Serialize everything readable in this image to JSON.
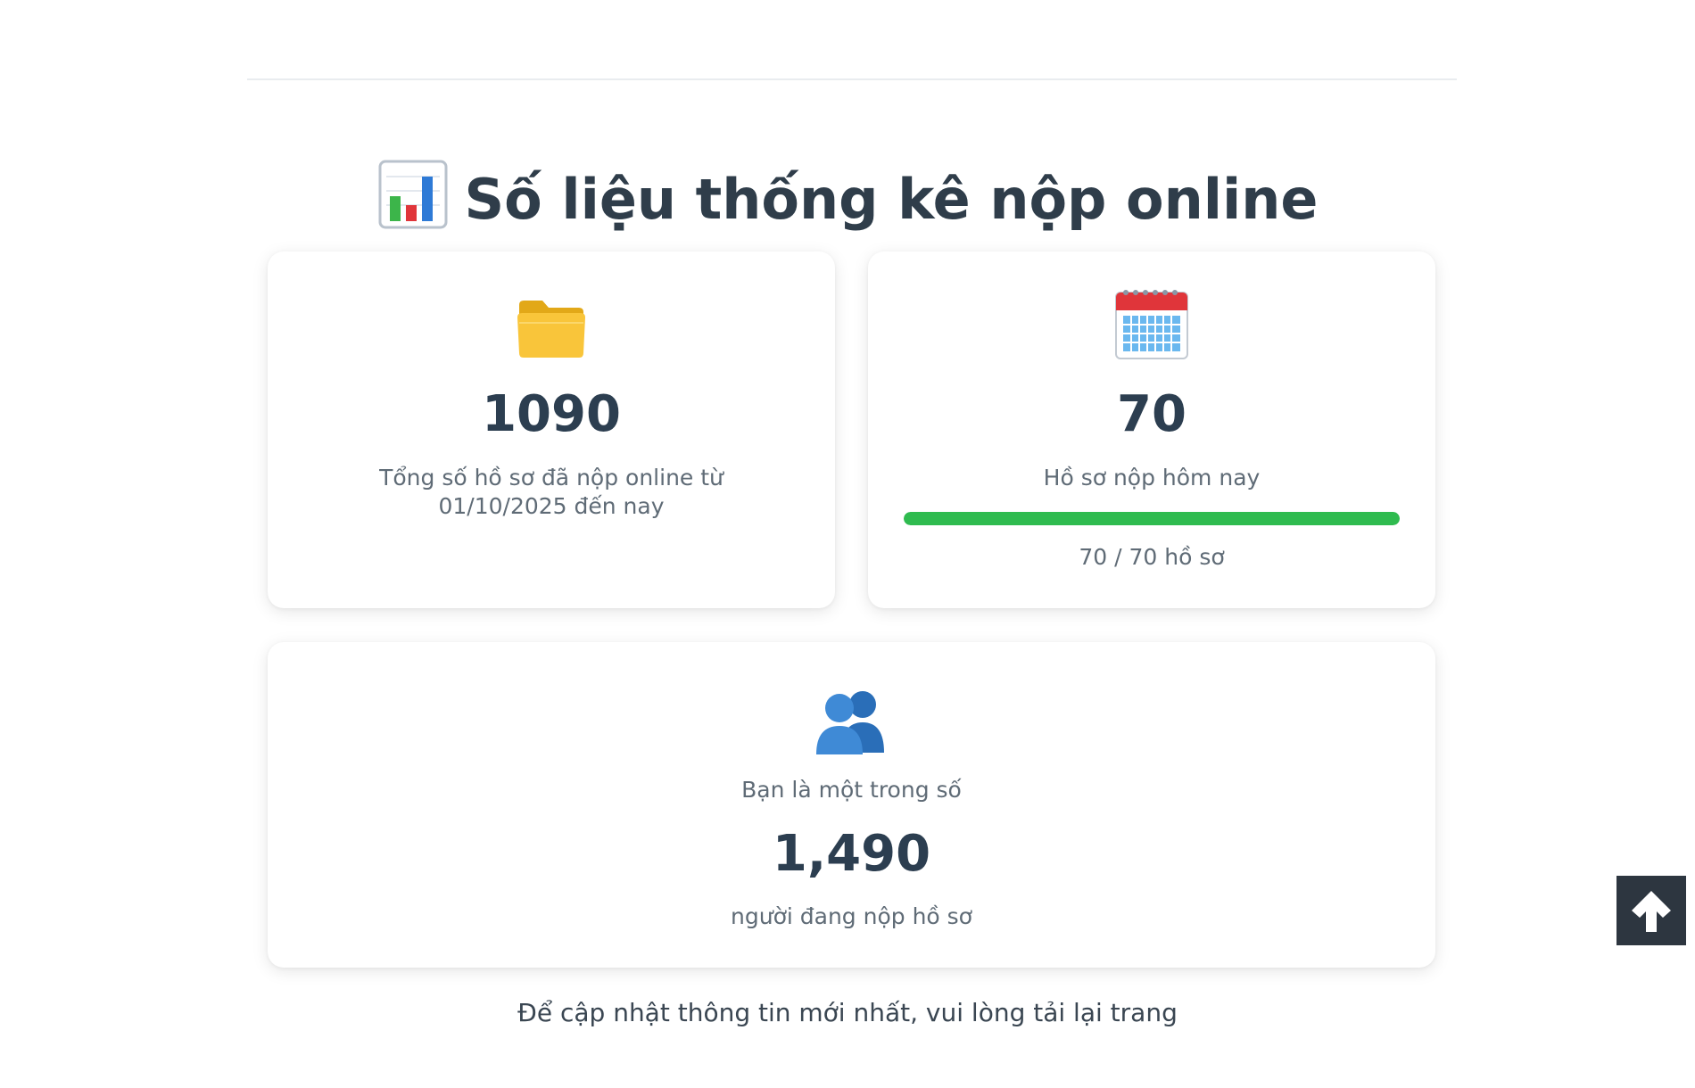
{
  "header": {
    "title": "Số liệu thống kê nộp online",
    "icon": "bar-chart-icon"
  },
  "cards": {
    "total": {
      "icon": "folder-icon",
      "value": "1090",
      "description": "Tổng số hồ sơ đã nộp online từ 01/10/2025 đến nay"
    },
    "today": {
      "icon": "calendar-icon",
      "value": "70",
      "description": "Hồ sơ nộp hôm nay",
      "progress_fraction": 1.0,
      "progress_text": "70 / 70 hồ sơ",
      "progress_color": "#2fbb4f"
    },
    "users": {
      "icon": "people-icon",
      "lead": "Bạn là một trong số",
      "value": "1,490",
      "tail": "người đang nộp hồ sơ"
    }
  },
  "footer": {
    "note": "Để cập nhật thông tin mới nhất, vui lòng tải lại trang"
  },
  "scroll_top_button": {
    "icon": "arrow-up-icon"
  }
}
